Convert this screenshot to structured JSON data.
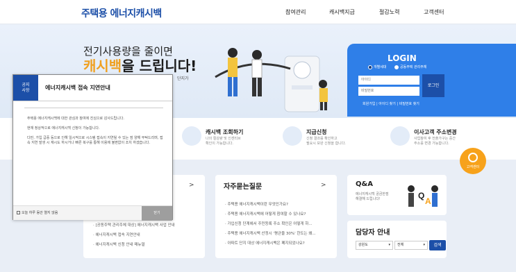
{
  "header": {
    "logo": "주택용 에너지캐시백",
    "nav": [
      "참여관리",
      "캐시백지급",
      "절감노력",
      "고객센터"
    ]
  },
  "hero": {
    "line1": "전기사용량을 줄이면",
    "line2_highlight": "캐시백",
    "line2_rest": "을 드립니다!",
    "sub": "단지가"
  },
  "login": {
    "title": "LOGIN",
    "radio_1": "개별세대",
    "radio_2": "공동주택 관리주체",
    "id_placeholder": "아이디",
    "pw_placeholder": "비밀번호",
    "button": "로그인",
    "links": "회원가입 | 아이디 찾기 | 비밀번호 찾기"
  },
  "quick": {
    "items": [
      {
        "title": "캐시백 조회하기",
        "desc1": "나의 절감량 및 인센티브",
        "desc2": "확인이 가능합니다.",
        "icon": "monitor-won-icon"
      },
      {
        "title": "지급신청",
        "desc1": "신청 결과를 확인하고",
        "desc2": "필요시 보완 신청을 합니다.",
        "icon": "computer-icon"
      },
      {
        "title": "이사고객 주소변경",
        "desc1": "사업참여 후 전출가구는 중간",
        "desc2": "주소를 변경 가능합니다.",
        "icon": "map-pin-icon"
      }
    ]
  },
  "badge": {
    "label": "고객센터"
  },
  "notice_card": {
    "items": [
      "[공동주택 관리주체 대상] 에너지캐시백 사업 안내",
      "에너지캐시백 접속 지연안내",
      "에너지캐시백 신청 안내 매뉴얼"
    ]
  },
  "faq": {
    "title": "자주묻는질문",
    "items": [
      "주택용 에너지캐시백이란 무엇인가요?",
      "주택용 에너지캐시백에 어떻게 참여할 수 있나요?",
      "가입신청 단계에서 주민등록 주소 확인은 어떻게 하...",
      "주택용 에너지캐시백 산정시 '평균을 30%' 한도는 왜...",
      "아파트 단지 대상 에너지캐시백은 폐지되었나요?"
    ]
  },
  "qa": {
    "title": "Q&A",
    "desc1": "에너지캐시백 궁금한점",
    "desc2": "해결해 드립니다!"
  },
  "manager": {
    "title": "담당자 안내",
    "region": "강원도",
    "scope": "전체",
    "search": "검색"
  },
  "popup": {
    "tag_line1": "공지",
    "tag_line2": "사항",
    "title": "에너지캐시백 접속 지연안내",
    "p1": "주택용 에너지캐시백에 대한 관심과 참여에 진심으로 감사드립니다.",
    "p2": "현재 정상적으로 에너지캐시백 신청이 가능합니다.",
    "p3": "다만, 가입 급증 등으로 인해 일시적으로 시스템 접속이 지연될 수 있는 점 양해 부탁드리며, 접속 지연 발생 시 재시도 하시거나 빠른 복구를 통해 이용에 불편없이 조치 하겠습니다.",
    "no_show": "오늘 하루 동안 열지 않음",
    "close": "닫기"
  }
}
